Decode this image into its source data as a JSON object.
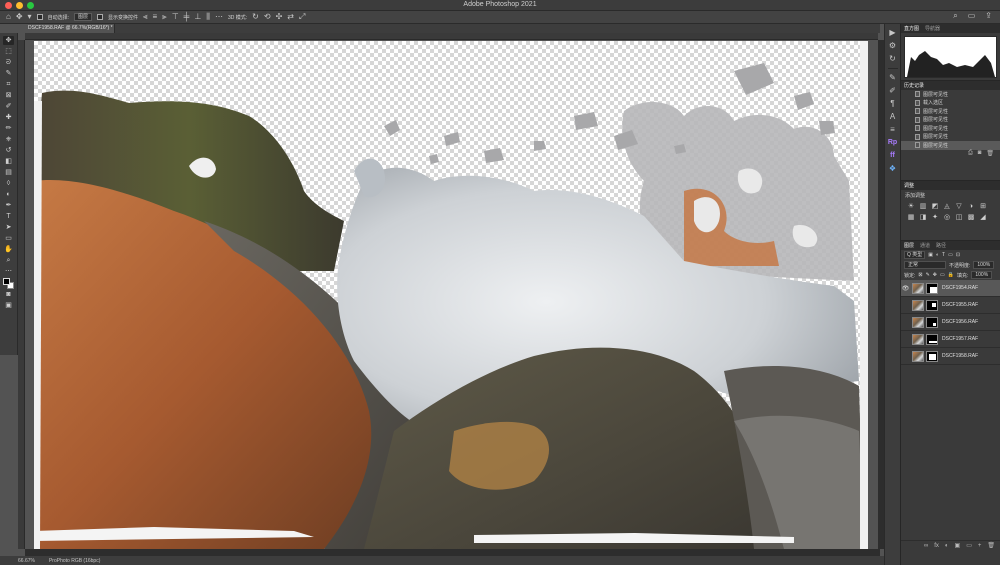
{
  "window": {
    "title": "Adobe Photoshop 2021"
  },
  "traffic_lights": {
    "close": "#ff5f57",
    "minimize": "#febc2e",
    "maximize": "#28c840"
  },
  "options_bar": {
    "auto_select_label": "自动选择:",
    "auto_select_value": "图层",
    "show_transform_label": "显示变换控件",
    "mode_3d_label": "3D 模式:"
  },
  "document": {
    "tab_title": "DSCF1958.RAF @ 66.7%(RGB/16*) *",
    "zoom": "66.67%",
    "color_profile": "ProPhoto RGB (16bpc)"
  },
  "tools": [
    "move-icon",
    "artboard-icon",
    "marquee-icon",
    "lasso-icon",
    "quick-select-icon",
    "crop-icon",
    "frame-icon",
    "eyedropper-icon",
    "healing-icon",
    "brush-icon",
    "stamp-icon",
    "history-brush-icon",
    "eraser-icon",
    "gradient-icon",
    "blur-icon",
    "dodge-icon",
    "pen-icon",
    "type-icon",
    "path-select-icon",
    "shape-icon",
    "hand-icon",
    "zoom-icon",
    "more-icon"
  ],
  "tool_glyphs": [
    "✥",
    "▭",
    "⬚",
    "ᘐ",
    "✎",
    "⌗",
    "⊠",
    "✐",
    "✚",
    "✏",
    "⎈",
    "↺",
    "◧",
    "▤",
    "💧",
    "◐",
    "✒",
    "T",
    "➤",
    "▭",
    "✋",
    "🔍",
    "…"
  ],
  "right_strip": [
    "play-icon",
    "adjust-icon",
    "history-icon",
    "brush-settings-icon",
    "brushes-icon",
    "paragraph-icon",
    "character-icon",
    "properties-icon",
    "rp-icon",
    "ff-icon",
    "shapes-icon"
  ],
  "right_strip_glyphs": [
    "▶",
    "⚙",
    "↻",
    "✎",
    "✐",
    "¶",
    "A",
    "≡",
    "Rp",
    "ff",
    "❖"
  ],
  "histogram_panel": {
    "tabs": [
      "直方图",
      "导航器"
    ]
  },
  "history_panel": {
    "title": "历史记录",
    "items": [
      "图层可见性",
      "载入选区",
      "图层可见性",
      "图层可见性",
      "图层可见性",
      "图层可见性",
      "图层可见性"
    ]
  },
  "adjustments_panel": {
    "tabs": [
      "调整"
    ],
    "add_label": "添加调整",
    "icons": [
      "☀",
      "▥",
      "◩",
      "◬",
      "▽",
      "◑",
      "⊞",
      "▦",
      "◨",
      "✦",
      "◎",
      "◫",
      "▩",
      "◢"
    ]
  },
  "layers_panel": {
    "tabs": [
      "图层",
      "通道",
      "路径"
    ],
    "filter_kind": "Q 类型",
    "blend_mode": "正常",
    "opacity_label": "不透明度:",
    "opacity_value": "100%",
    "lock_label": "锁定:",
    "fill_label": "填充:",
    "fill_value": "100%",
    "layers": [
      {
        "name": "DSCF1954.RAF",
        "visible": true,
        "selected": true
      },
      {
        "name": "DSCF1955.RAF",
        "visible": false,
        "selected": false
      },
      {
        "name": "DSCF1956.RAF",
        "visible": false,
        "selected": false
      },
      {
        "name": "DSCF1957.RAF",
        "visible": false,
        "selected": false
      },
      {
        "name": "DSCF1958.RAF",
        "visible": false,
        "selected": false
      }
    ],
    "footer_icons": [
      "∞",
      "fx",
      "◐",
      "▣",
      "▭",
      "+",
      "🗑"
    ]
  }
}
